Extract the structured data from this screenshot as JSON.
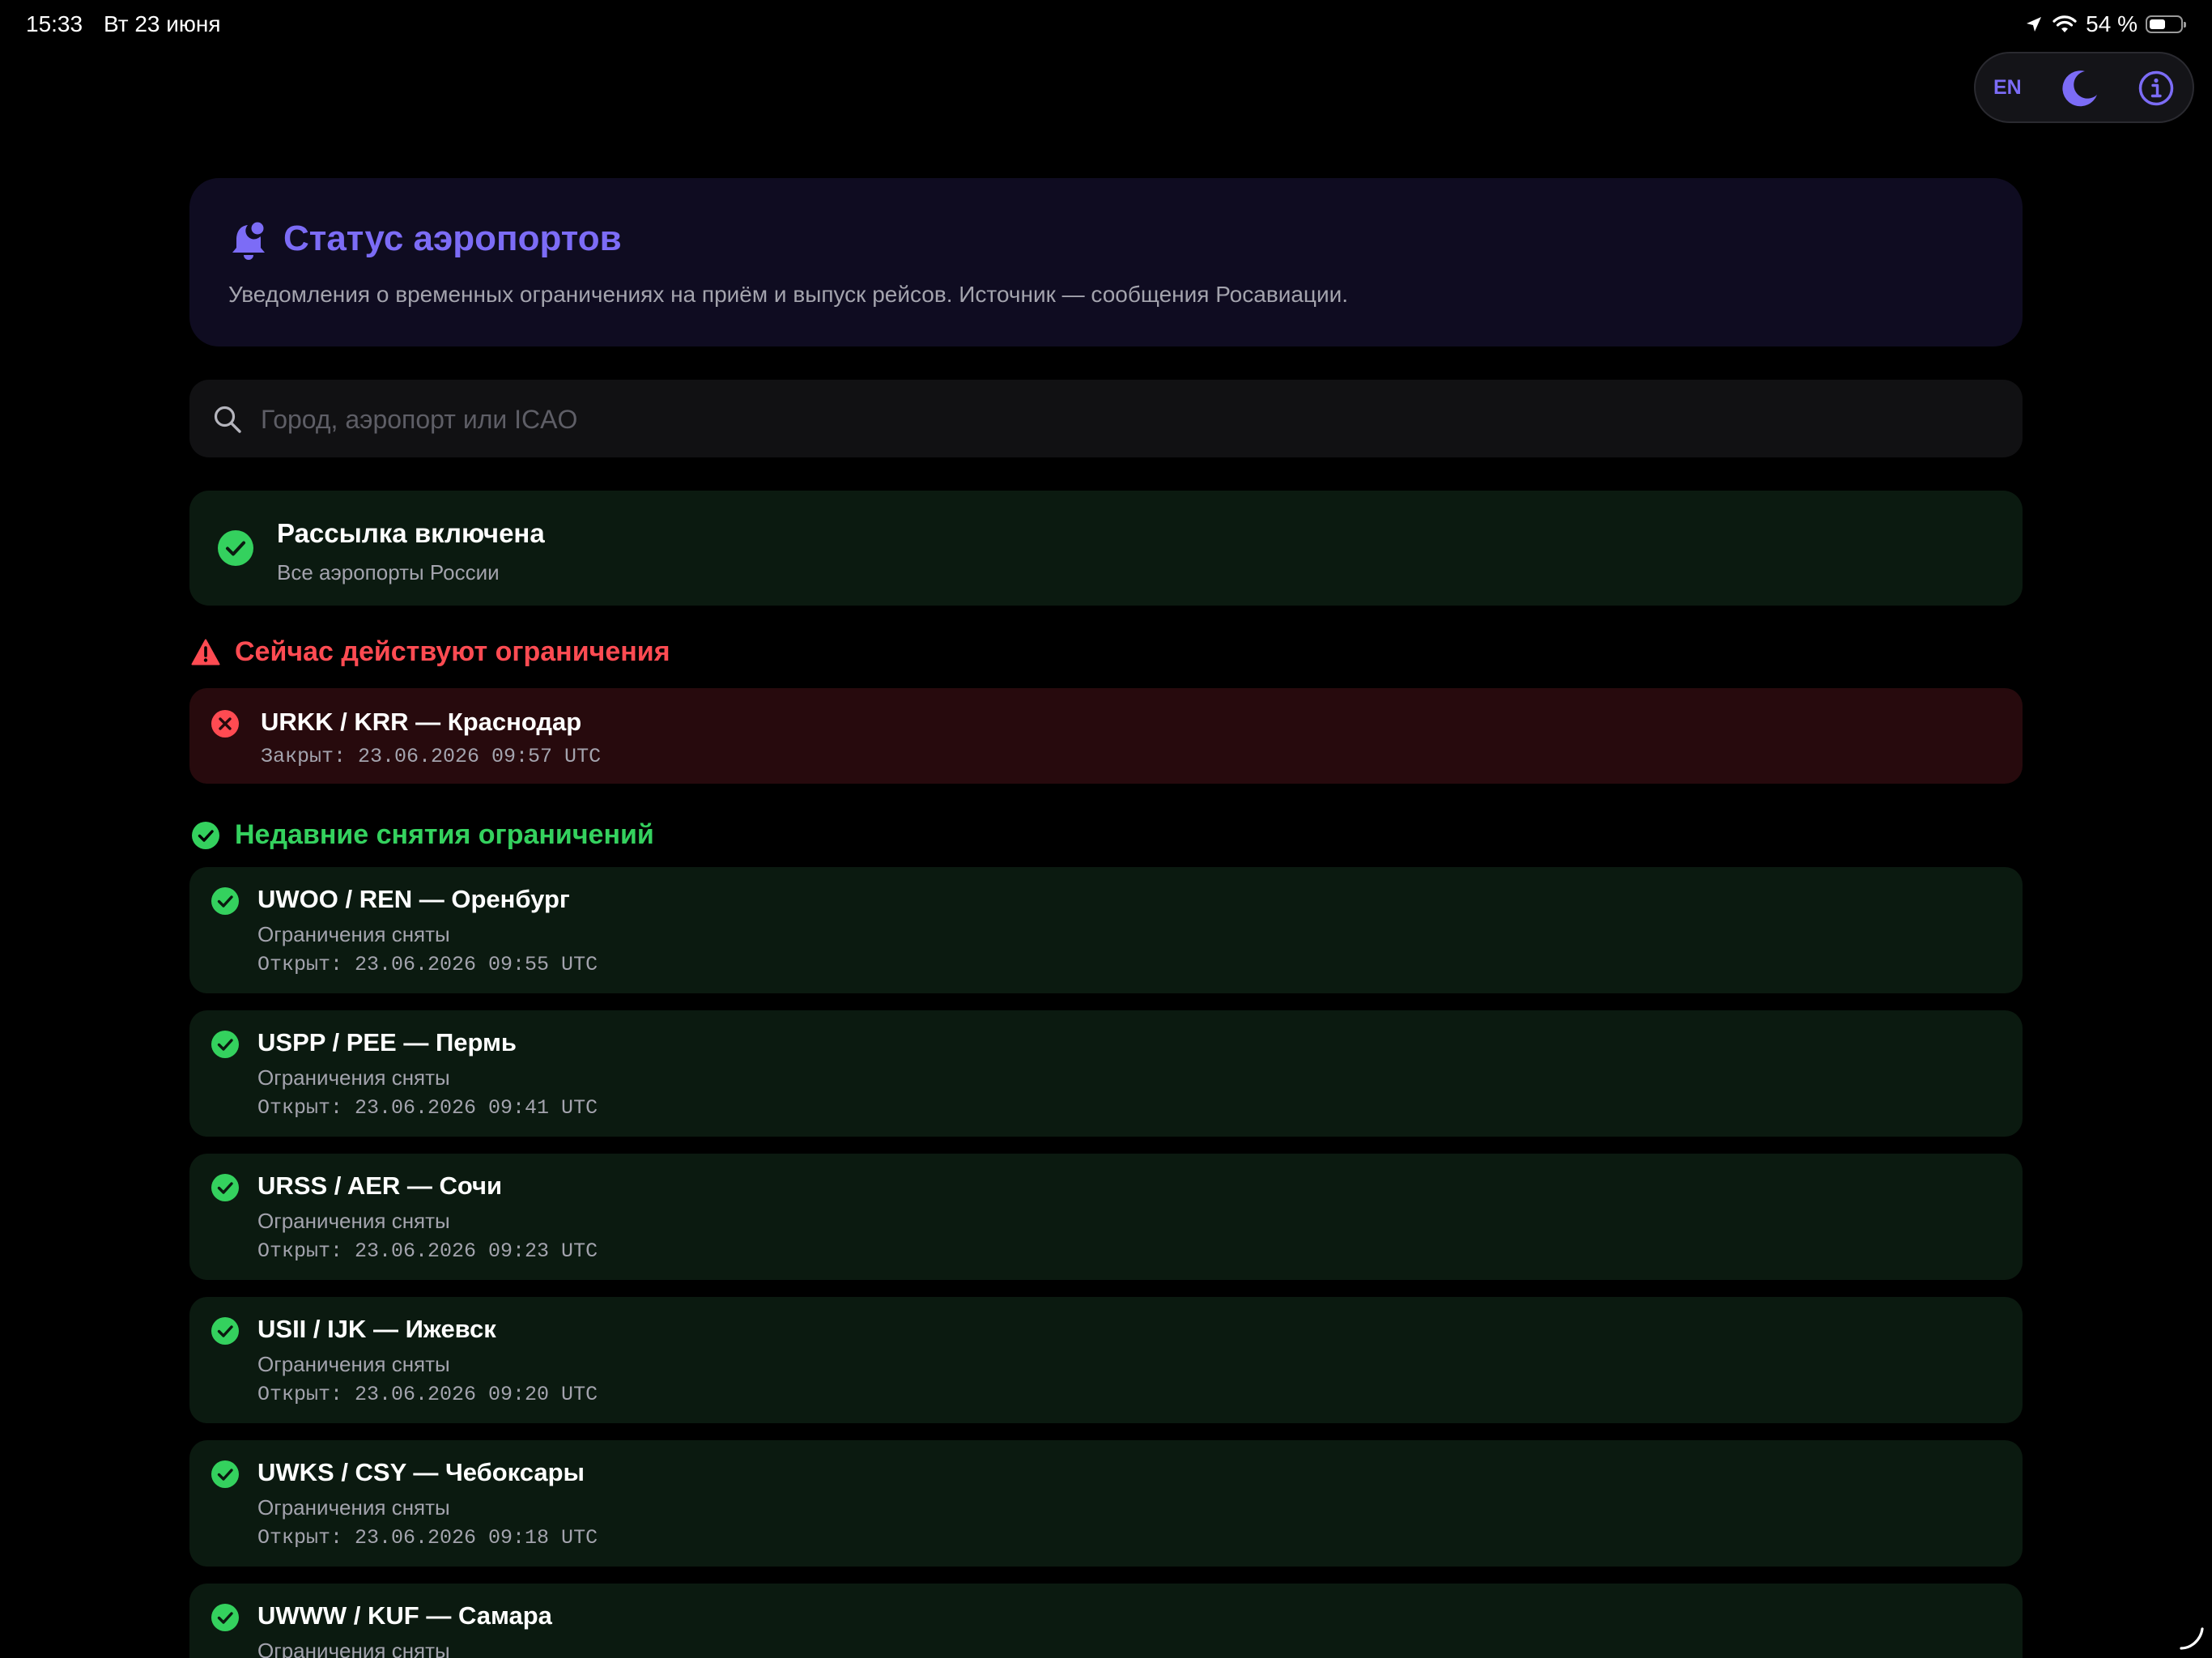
{
  "status_bar": {
    "time": "15:33",
    "date": "Вт 23 июня",
    "battery_text": "54 %",
    "battery_level": 0.54
  },
  "toolbar": {
    "language_label": "EN",
    "theme_icon": "moon-icon",
    "info_icon": "info-icon"
  },
  "header": {
    "title": "Статус аэропортов",
    "subtitle": "Уведомления о временных ограничениях на приём и выпуск рейсов. Источник — сообщения Росавиации.",
    "icon": "bell-icon"
  },
  "search": {
    "placeholder": "Город, аэропорт или ICAO",
    "value": ""
  },
  "subscription": {
    "title": "Рассылка включена",
    "description": "Все аэропорты России"
  },
  "active_section": {
    "title": "Сейчас действуют ограничения",
    "items": [
      {
        "title": "URKK / KRR — Краснодар",
        "time": "Закрыт: 23.06.2026 09:57 UTC"
      }
    ]
  },
  "recent_section": {
    "title": "Недавние снятия ограничений",
    "items": [
      {
        "title": "UWOO / REN — Оренбург",
        "status": "Ограничения сняты",
        "time": "Открыт: 23.06.2026 09:55 UTC"
      },
      {
        "title": "USPP / PEE — Пермь",
        "status": "Ограничения сняты",
        "time": "Открыт: 23.06.2026 09:41 UTC"
      },
      {
        "title": "URSS / AER — Сочи",
        "status": "Ограничения сняты",
        "time": "Открыт: 23.06.2026 09:23 UTC"
      },
      {
        "title": "USII / IJK — Ижевск",
        "status": "Ограничения сняты",
        "time": "Открыт: 23.06.2026 09:20 UTC"
      },
      {
        "title": "UWKS / CSY — Чебоксары",
        "status": "Ограничения сняты",
        "time": "Открыт: 23.06.2026 09:18 UTC"
      },
      {
        "title": "UWWW / KUF — Самара",
        "status": "Ограничения сняты",
        "time": ""
      }
    ]
  },
  "colors": {
    "accent": "#7c6cf6",
    "success": "#34d15e",
    "danger": "#ff4b52",
    "background": "#000000"
  }
}
